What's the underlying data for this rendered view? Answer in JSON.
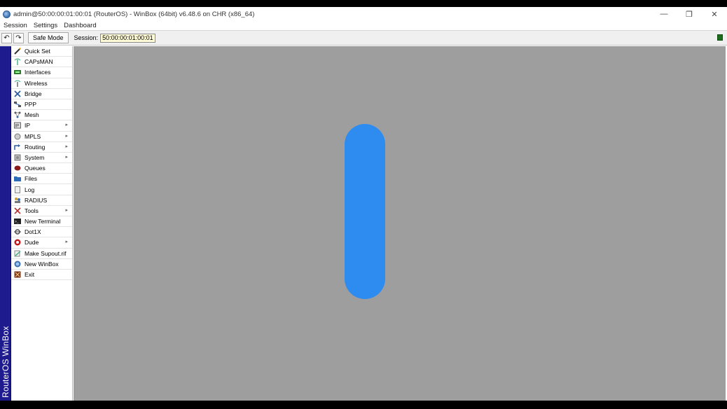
{
  "window": {
    "title": "admin@50:00:00:01:00:01 (RouterOS) - WinBox (64bit) v6.48.6 on CHR (x86_64)",
    "controls": {
      "minimize": "—",
      "restore": "❐",
      "close": "✕"
    }
  },
  "menubar": {
    "items": [
      "Session",
      "Settings",
      "Dashboard"
    ]
  },
  "toolbar": {
    "undo": "↶",
    "redo": "↷",
    "safe_mode": "Safe Mode",
    "session_label": "Session:",
    "session_value": "50:00:00:01:00:01",
    "status_color": "#1d6d1d"
  },
  "brand": {
    "text": "RouterOS WinBox",
    "color": "#1d1b8e"
  },
  "sidebar": {
    "items": [
      {
        "label": "Quick Set",
        "icon": "wand-icon",
        "submenu": false
      },
      {
        "label": "CAPsMAN",
        "icon": "antenna-icon",
        "submenu": false
      },
      {
        "label": "Interfaces",
        "icon": "interfaces-icon",
        "submenu": false
      },
      {
        "label": "Wireless",
        "icon": "wireless-icon",
        "submenu": false
      },
      {
        "label": "Bridge",
        "icon": "bridge-icon",
        "submenu": false
      },
      {
        "label": "PPP",
        "icon": "ppp-icon",
        "submenu": false
      },
      {
        "label": "Mesh",
        "icon": "mesh-icon",
        "submenu": false
      },
      {
        "label": "IP",
        "icon": "ip-icon",
        "submenu": true
      },
      {
        "label": "MPLS",
        "icon": "mpls-icon",
        "submenu": true
      },
      {
        "label": "Routing",
        "icon": "routing-icon",
        "submenu": true
      },
      {
        "label": "System",
        "icon": "system-icon",
        "submenu": true
      },
      {
        "label": "Queues",
        "icon": "queues-icon",
        "submenu": false
      },
      {
        "label": "Files",
        "icon": "folder-icon",
        "submenu": false
      },
      {
        "label": "Log",
        "icon": "log-icon",
        "submenu": false
      },
      {
        "label": "RADIUS",
        "icon": "radius-icon",
        "submenu": false
      },
      {
        "label": "Tools",
        "icon": "tools-icon",
        "submenu": true
      },
      {
        "label": "New Terminal",
        "icon": "terminal-icon",
        "submenu": false
      },
      {
        "label": "Dot1X",
        "icon": "dot1x-icon",
        "submenu": false
      },
      {
        "label": "Dude",
        "icon": "dude-icon",
        "submenu": true
      },
      {
        "label": "Make Supout.rif",
        "icon": "supout-icon",
        "submenu": false
      },
      {
        "label": "New WinBox",
        "icon": "winbox-icon",
        "submenu": false
      },
      {
        "label": "Exit",
        "icon": "exit-icon",
        "submenu": false
      }
    ],
    "submenu_arrow": "▸"
  },
  "workspace": {
    "background": "#9e9e9f",
    "pill_color": "#2e8cf0"
  }
}
